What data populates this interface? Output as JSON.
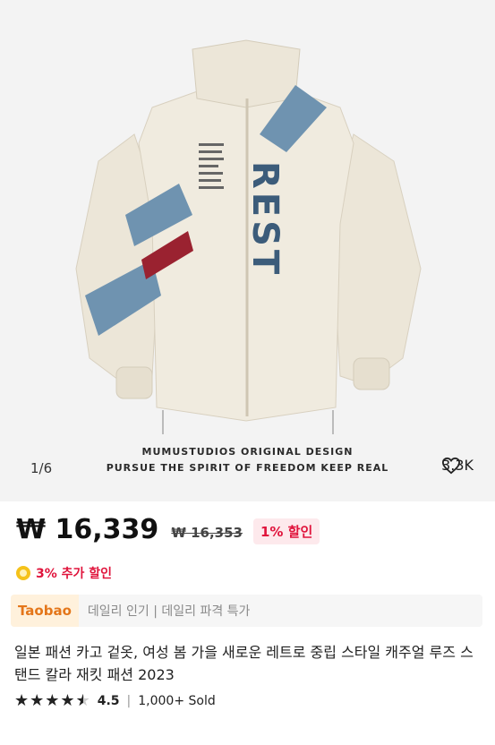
{
  "gallery": {
    "counter": "1/6",
    "likes": "3.3K",
    "image_tagline_1": "MUMUSTUDIOS ORIGINAL DESIGN",
    "image_tagline_2": "PURSUE THE SPIRIT OF FREEDOM KEEP REAL",
    "jacket_print": "REST",
    "icon": "heart-icon"
  },
  "pricing": {
    "price": "₩ 16,339",
    "original_price": "₩ 16,353",
    "discount": "1% 할인",
    "extra_discount": "3% 추가 할인",
    "accent_color": "#e0143c"
  },
  "promo": {
    "badge": "Taobao",
    "text": "데일리 인기 | 데일리 파격 특가"
  },
  "product": {
    "title": "일본 패션 카고 겉옷, 여성 봄 가을 새로운 레트로 중립 스타일 캐주얼 루즈 스탠드 칼라 재킷 패션 2023",
    "rating": "4.5",
    "rating_value": 4.5,
    "separator": "|",
    "sold": "1,000+ Sold"
  }
}
